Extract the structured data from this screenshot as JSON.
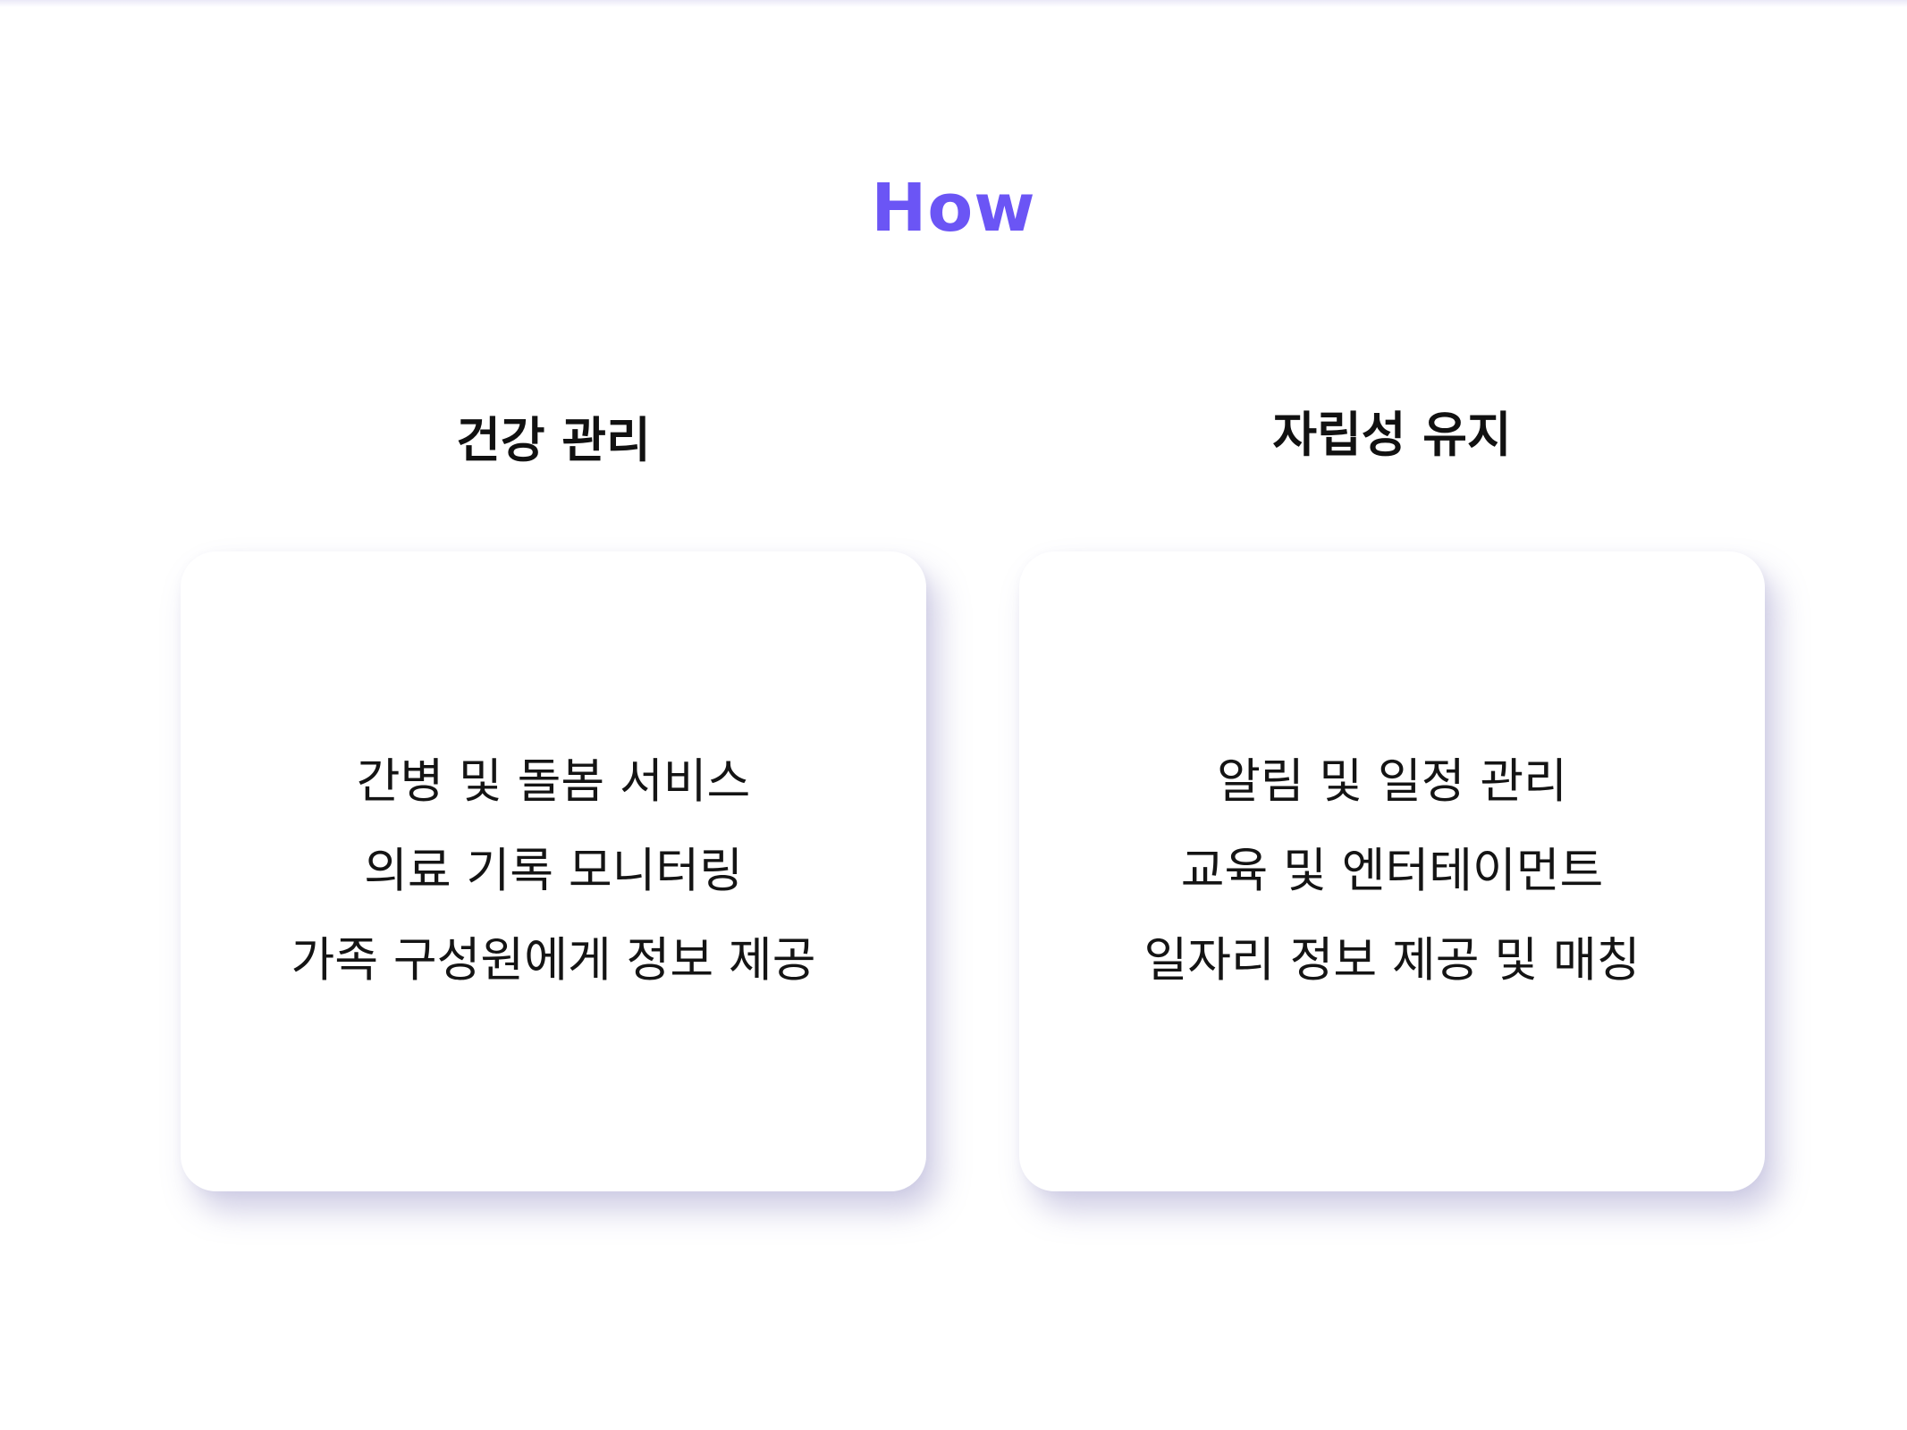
{
  "section": {
    "heading": "How",
    "accent_color": "#6b55f5"
  },
  "columns": [
    {
      "title": "건강 관리",
      "items": [
        "간병 및 돌봄 서비스",
        "의료 기록 모니터링",
        "가족 구성원에게 정보 제공"
      ]
    },
    {
      "title": "자립성 유지",
      "items": [
        "알림 및 일정 관리",
        "교육 및 엔터테이먼트",
        "일자리 정보 제공 및 매칭"
      ]
    }
  ]
}
